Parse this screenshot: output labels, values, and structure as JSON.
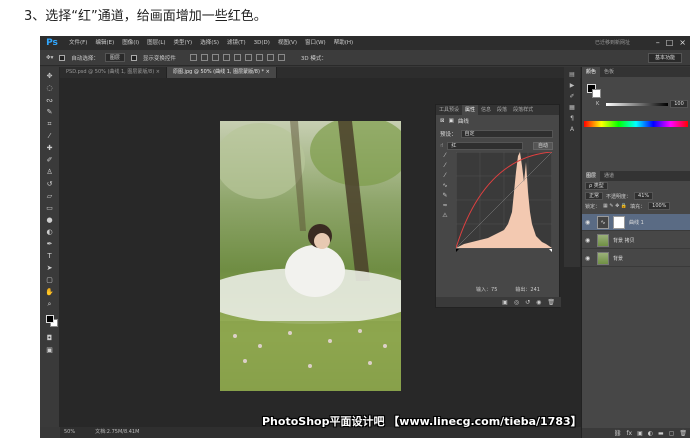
{
  "caption": "3、选择“红”通道，给画面增加一些红色。",
  "app": {
    "logo": "Ps",
    "menu": [
      "文件(F)",
      "编辑(E)",
      "图像(I)",
      "图层(L)",
      "类型(Y)",
      "选择(S)",
      "滤镜(T)",
      "3D(D)",
      "视图(V)",
      "窗口(W)",
      "帮助(H)"
    ],
    "top_watermark": "已迁移到新网址",
    "window_controls": [
      "–",
      "□",
      "×"
    ]
  },
  "options": {
    "auto_select_label": "自动选择：",
    "auto_select_value": "图层",
    "show_transform": "显示变换控件",
    "mode_3d": "3D 模式：",
    "workspace": "基本功能"
  },
  "tabs": [
    {
      "label": "PSD.psd @ 50% (曲线 1, 图层蒙版/8) ×"
    },
    {
      "label": "原图.jpg @ 50% (曲线 1, 图层蒙版/8) * ×"
    }
  ],
  "toolbar_icons": [
    "move-icon",
    "marquee-icon",
    "lasso-icon",
    "quick-select-icon",
    "crop-icon",
    "eyedropper-icon",
    "healing-icon",
    "brush-icon",
    "clone-stamp-icon",
    "history-brush-icon",
    "eraser-icon",
    "gradient-icon",
    "blur-icon",
    "dodge-icon",
    "pen-icon",
    "type-icon",
    "path-select-icon",
    "shape-icon",
    "hand-icon",
    "zoom-icon"
  ],
  "status": {
    "zoom": "50%",
    "doc": "文档:2.75M/8.41M"
  },
  "properties": {
    "tabs": [
      "工具预设",
      "属性",
      "信息",
      "段落",
      "段落样式"
    ],
    "header": "曲线",
    "preset_label": "预设：",
    "preset_value": "自定",
    "channel_value": "红",
    "auto_button": "自动",
    "input_label": "输入：",
    "input_value": "75",
    "output_label": "输出：",
    "output_value": "241"
  },
  "color_panel": {
    "tabs": [
      "颜色",
      "色板"
    ],
    "k_label": "K",
    "k_value": "100",
    "k_unit": "%"
  },
  "layers_panel": {
    "tabs": [
      "图层",
      "通道"
    ],
    "kind": "ρ 类型",
    "blend_mode": "正常",
    "opacity_label": "不透明度：",
    "opacity_value": "41%",
    "lock_label": "锁定：",
    "fill_label": "填充：",
    "fill_value": "100%",
    "layers": [
      {
        "name": "曲线 1",
        "selected": true
      },
      {
        "name": "背景 拷贝",
        "selected": false
      },
      {
        "name": "背景",
        "selected": false
      }
    ]
  },
  "bottom_watermark": "PhotoShop平面设计吧 【www.linecg.com/tieba/1783】",
  "curve": {
    "channel": "red",
    "input": 75,
    "output": 241,
    "accent_color": "#e04040"
  }
}
